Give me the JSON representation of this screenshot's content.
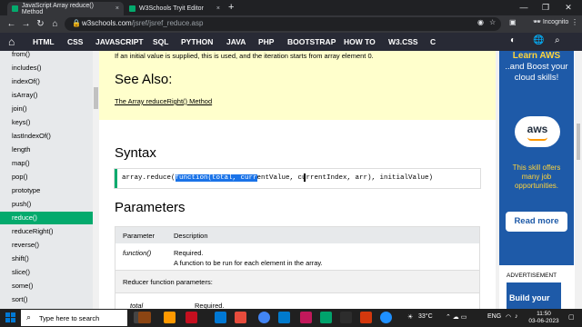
{
  "browser": {
    "tabs": [
      {
        "title": "JavaScript Array reduce() Method",
        "close": "×",
        "active": true
      },
      {
        "title": "W3Schools Tryit Editor",
        "close": "×",
        "active": false
      }
    ],
    "new_tab": "+",
    "url_host": "w3schools.com",
    "url_path": "/jsref/jsref_reduce.asp",
    "profile": "Incognito"
  },
  "nav": {
    "items": [
      "HTML",
      "CSS",
      "JAVASCRIPT",
      "SQL",
      "PYTHON",
      "JAVA",
      "PHP",
      "BOOTSTRAP",
      "HOW TO",
      "W3.CSS",
      "C"
    ]
  },
  "sidebar": {
    "items": [
      {
        "label": "from()",
        "active": false
      },
      {
        "label": "includes()",
        "active": false
      },
      {
        "label": "indexOf()",
        "active": false
      },
      {
        "label": "isArray()",
        "active": false
      },
      {
        "label": "join()",
        "active": false
      },
      {
        "label": "keys()",
        "active": false
      },
      {
        "label": "lastIndexOf()",
        "active": false
      },
      {
        "label": "length",
        "active": false
      },
      {
        "label": "map()",
        "active": false
      },
      {
        "label": "pop()",
        "active": false
      },
      {
        "label": "prototype",
        "active": false
      },
      {
        "label": "push()",
        "active": false
      },
      {
        "label": "reduce()",
        "active": true
      },
      {
        "label": "reduceRight()",
        "active": false
      },
      {
        "label": "reverse()",
        "active": false
      },
      {
        "label": "shift()",
        "active": false
      },
      {
        "label": "slice()",
        "active": false
      },
      {
        "label": "some()",
        "active": false
      },
      {
        "label": "sort()",
        "active": false
      }
    ]
  },
  "content": {
    "note_text": "If an initial value is supplied, this is used, and the iteration starts from array element 0.",
    "see_also_title": "See Also:",
    "see_also_link": "The Array reduceRight() Method",
    "syntax_title": "Syntax",
    "code_pre": "array.reduce(",
    "code_highlight": "function(total, curr",
    "code_post": "entValue, currentIndex, arr), initialValue)",
    "parameters_title": "Parameters",
    "table": {
      "headers": [
        "Parameter",
        "Description"
      ],
      "row1_param": "function()",
      "row1_desc1": "Required.",
      "row1_desc2": "A function to be run for each element in the array.",
      "reducer_label": "Reducer function parameters:",
      "row2_param": "total",
      "row2_desc": "Required."
    }
  },
  "ad": {
    "line1": "Learn AWS",
    "line2": "..and Boost your cloud skills!",
    "logo_text": "aws",
    "line3": "This skill offers many job opportunities.",
    "button": "Read more",
    "label": "ADVERTISEMENT",
    "ad2_text": "Build your"
  },
  "taskbar": {
    "search_placeholder": "Type here to search",
    "weather": "33°C",
    "lang": "ENG",
    "time": "11:50",
    "date": "03-06-2023"
  }
}
